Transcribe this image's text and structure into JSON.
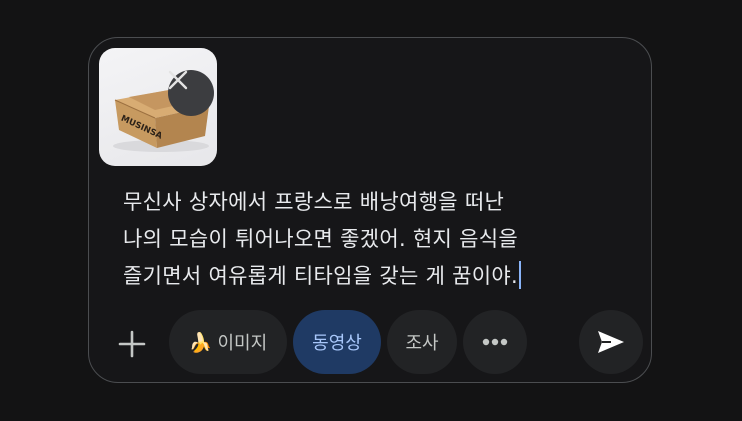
{
  "attachment": {
    "box_text": "MUSINSA"
  },
  "prompt": {
    "text": "무신사 상자에서 프랑스로 배낭여행을 떠난\n나의 모습이 튀어나오면 좋겠어. 현지 음식을\n즐기면서 여유롭게 티타임을 갖는 게 꿈이야."
  },
  "toolbar": {
    "image_label": "이미지",
    "image_icon": "🍌",
    "video_label": "동영상",
    "research_label": "조사"
  },
  "colors": {
    "background": "#131314",
    "active_chip": "#1f3a64",
    "active_text": "#a8c7fa",
    "caret": "#8ab4f8"
  }
}
